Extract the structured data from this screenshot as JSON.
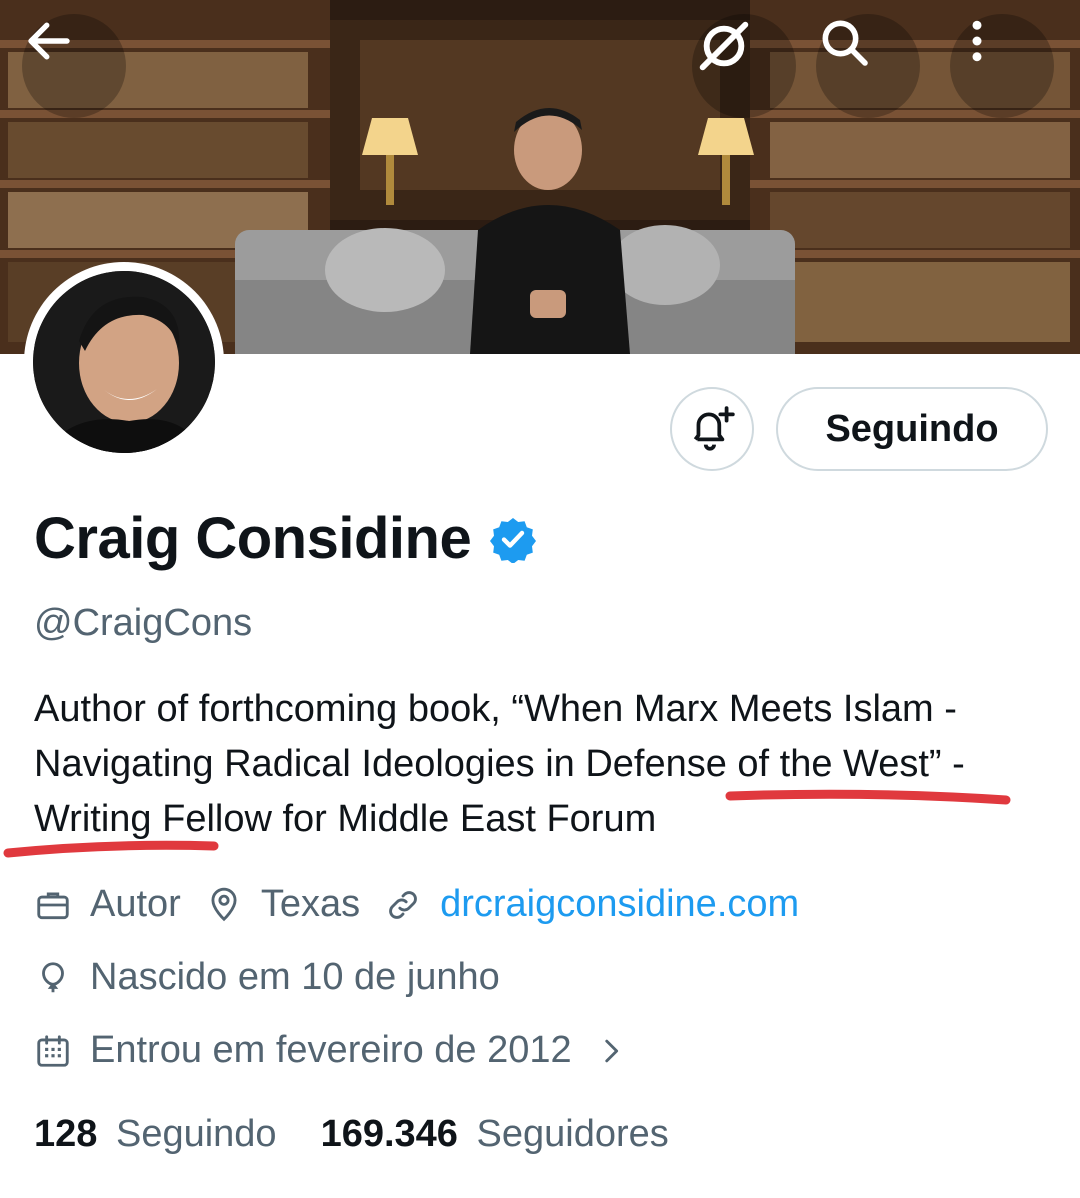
{
  "profile": {
    "name": "Craig Considine",
    "handle": "@CraigCons",
    "bio": "Author of forthcoming book, “When Marx Meets Islam - Navigating Radical Ideologies in Defense of the West” - Writing Fellow for Middle East Forum",
    "verified": true
  },
  "buttons": {
    "follow_label": "Seguindo",
    "notify_icon": "bell-plus-icon"
  },
  "header": {
    "back_icon": "arrow-left-icon",
    "grok_icon": "grok-icon",
    "search_icon": "search-icon",
    "more_icon": "more-vertical-icon"
  },
  "meta": {
    "profession": "Autor",
    "location": "Texas",
    "website": "drcraigconsidine.com",
    "birthday": "Nascido em 10 de junho",
    "joined": "Entrou em fevereiro de 2012"
  },
  "stats": {
    "following_count": "128",
    "following_label": "Seguindo",
    "followers_count": "169.346",
    "followers_label": "Seguidores"
  },
  "colors": {
    "accent": "#1d9bf0",
    "secondary_text": "#536471",
    "annotation": "#e0393e"
  }
}
